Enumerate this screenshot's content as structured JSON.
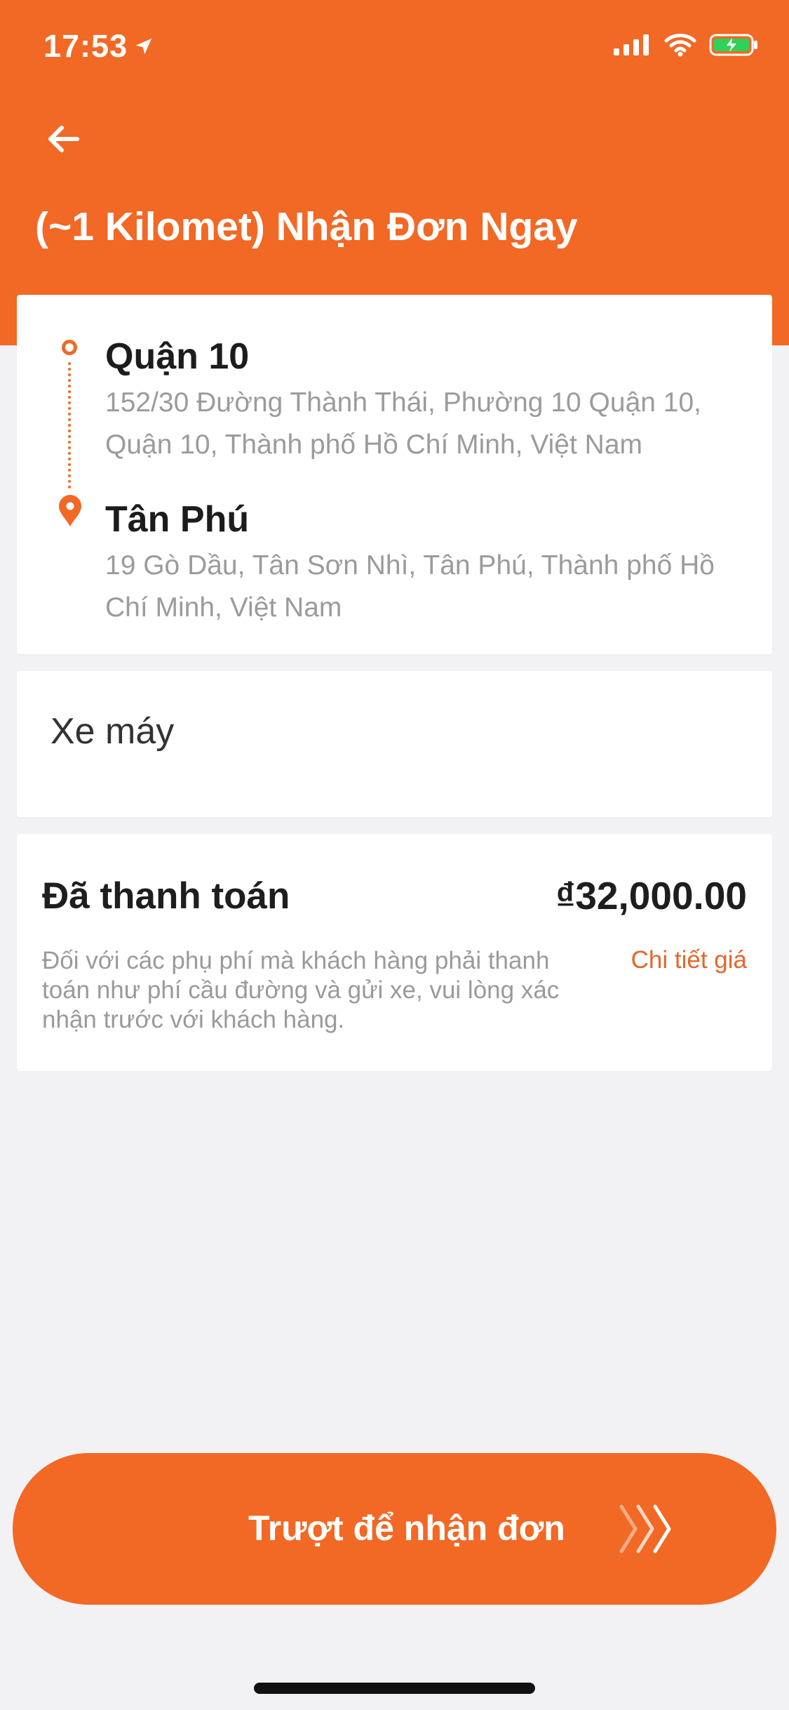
{
  "status_bar": {
    "time": "17:53",
    "icons": [
      "location-arrow-icon",
      "signal-icon",
      "wifi-icon",
      "battery-charging-icon"
    ]
  },
  "header": {
    "title": "(~1 Kilomet) Nhận Đơn Ngay",
    "back_icon": "arrow-left-icon"
  },
  "route": {
    "pickup": {
      "title": "Quận 10",
      "address": "152/30 Đường Thành Thái, Phường 10 Quận 10, Quận 10, Thành phố Hồ Chí Minh, Việt Nam"
    },
    "dropoff": {
      "title": "Tân Phú",
      "address": "19 Gò Dầu, Tân Sơn Nhì, Tân Phú, Thành phố Hồ Chí Minh, Việt Nam"
    }
  },
  "vehicle": {
    "label": "Xe máy"
  },
  "payment": {
    "status": "Đã thanh toán",
    "amount": "₫32,000.00",
    "note": "Đối với các phụ phí mà khách hàng phải thanh toán như phí cầu đường và gửi xe, vui lòng xác nhận trước với khách hàng.",
    "detail_link": "Chi tiết giá"
  },
  "action": {
    "swipe_label": "Trượt để nhận đơn"
  },
  "colors": {
    "accent": "#f26825",
    "background": "#f2f2f4",
    "card": "#ffffff"
  }
}
